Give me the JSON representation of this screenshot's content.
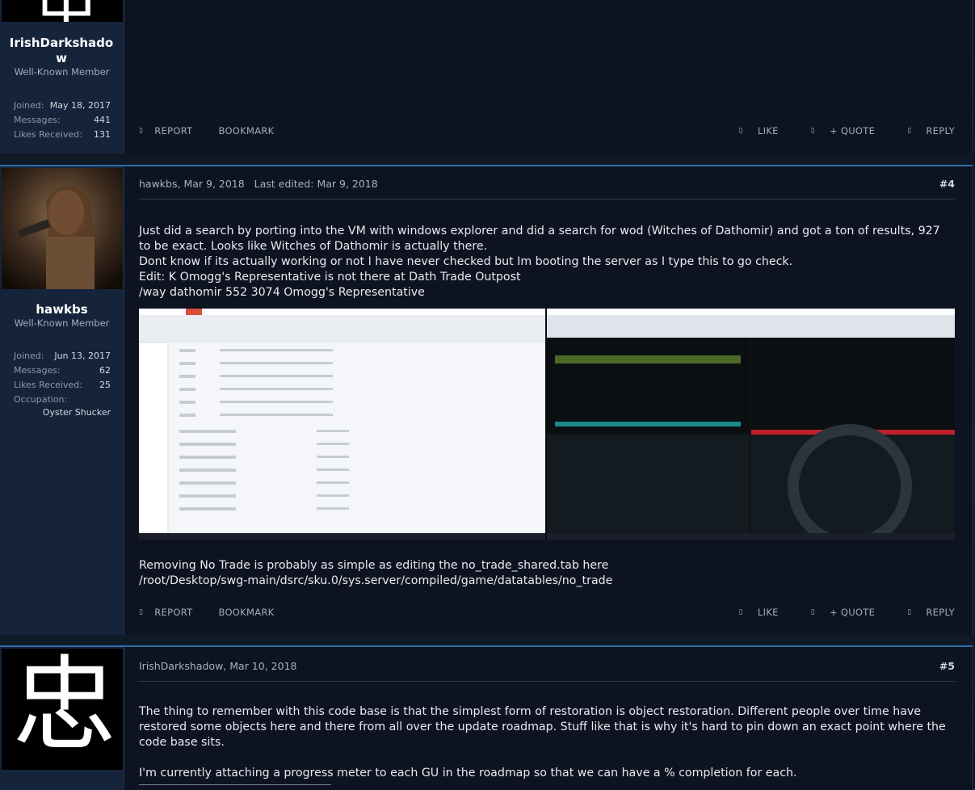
{
  "post3": {
    "username": "IrishDarkshadow",
    "user_title": "Well-Known Member",
    "stats": [
      {
        "label": "Joined:",
        "value": "May 18, 2017"
      },
      {
        "label": "Messages:",
        "value": "441"
      },
      {
        "label": "Likes Received:",
        "value": "131"
      }
    ],
    "actions": {
      "report": "REPORT",
      "bookmark": "BOOKMARK",
      "like": "LIKE",
      "quote": "+ QUOTE",
      "reply": "REPLY"
    }
  },
  "post4": {
    "username": "hawkbs",
    "user_title": "Well-Known Member",
    "stats": [
      {
        "label": "Joined:",
        "value": "Jun 13, 2017"
      },
      {
        "label": "Messages:",
        "value": "62"
      },
      {
        "label": "Likes Received:",
        "value": "25"
      }
    ],
    "occupation_label": "Occupation:",
    "occupation_value": "Oyster Shucker",
    "meta": "hawkbs, Mar 9, 2018   Last edited: Mar 9, 2018",
    "number": "#4",
    "lines": [
      "Just did a search by porting into the VM with windows explorer and did a search for wod (Witches of Dathomir) and got a ton of results, 927 to be exact. Looks like Witches of Dathomir is actually there.",
      "Dont know if its actually working or not I have never checked but Im booting the server as I type this to go check.",
      "Edit: K Omogg's Representative is not there at Dath Trade Outpost",
      "/way dathomir 552 3074 Omogg's Representative"
    ],
    "after_image": "Removing No Trade is probably as simple as editing the no_trade_shared.tab here /root/Desktop/swg-main/dsrc/sku.0/sys.server/compiled/game/datatables/no_trade",
    "actions": {
      "report": "REPORT",
      "bookmark": "BOOKMARK",
      "like": "LIKE",
      "quote": "+ QUOTE",
      "reply": "REPLY"
    }
  },
  "post5": {
    "avatar_glyph": "忠",
    "meta": "IrishDarkshadow, Mar 10, 2018",
    "number": "#5",
    "lines": [
      "The thing to remember with this code base is that the simplest form of restoration is object restoration. Different people over time have restored some objects here and there from all over the update roadmap. Stuff like that is why it's hard to pin down an exact point where the code base sits.",
      "I'm currently attaching a progress meter to each GU in the roadmap so that we can have a % completion for each."
    ]
  }
}
